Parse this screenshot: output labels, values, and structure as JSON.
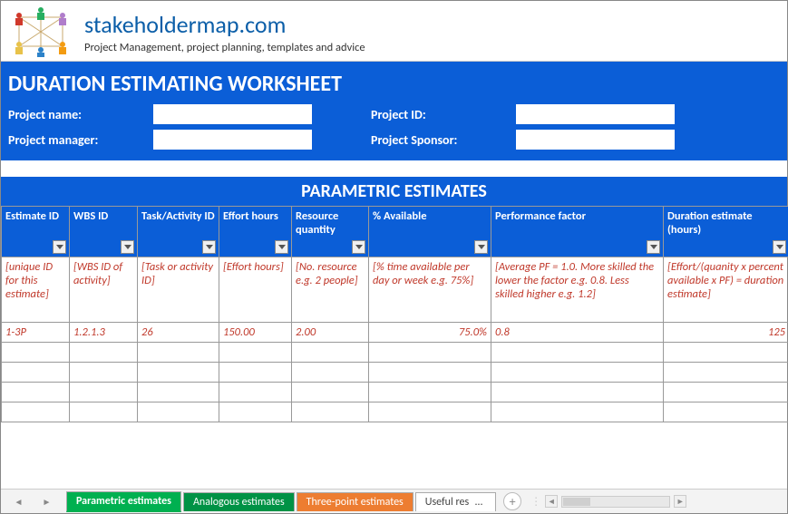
{
  "brand": {
    "site": "stakeholdermap.com",
    "tagline": "Project Management, project planning, templates and advice"
  },
  "title": "DURATION ESTIMATING WORKSHEET",
  "meta": {
    "project_name_label": "Project name:",
    "project_name_value": "",
    "project_id_label": "Project ID:",
    "project_id_value": "",
    "project_manager_label": "Project manager:",
    "project_manager_value": "",
    "project_sponsor_label": "Project Sponsor:",
    "project_sponsor_value": ""
  },
  "section_title": "PARAMETRIC ESTIMATES",
  "columns": {
    "c0": "Estimate ID",
    "c1": "WBS ID",
    "c2": "Task/Activity ID",
    "c3": "Effort hours",
    "c4": "Resource quantity",
    "c5": "% Available",
    "c6": "Performance factor",
    "c7": "Duration estimate (hours)"
  },
  "hints": {
    "c0": "[unique ID for this estimate]",
    "c1": "[WBS ID of activity]",
    "c2": "[Task or activity ID]",
    "c3": "[Effort hours]",
    "c4": "[No. resource e.g. 2 people]",
    "c5": "[% time available per day or week e.g. 75%]",
    "c6": "[Average PF = 1.0. More skilled the lower the factor e.g. 0.8. Less skilled higher e.g. 1.2]",
    "c7": "[Effort/(quanity x percent available x PF) = duration estimate]"
  },
  "row1": {
    "c0": "1-3P",
    "c1": "1.2.1.3",
    "c2": "26",
    "c3": "150.00",
    "c4": "2.00",
    "c5": "75.0%",
    "c6": "0.8",
    "c7": "125"
  },
  "tabs": {
    "t1": "Parametric estimates",
    "t2": "Analogous estimates",
    "t3": "Three-point estimates",
    "t4": "Useful res"
  },
  "colwidths": {
    "w0": 75,
    "w1": 75,
    "w2": 90,
    "w3": 80,
    "w4": 85,
    "w5": 135,
    "w6": 190,
    "w7": 139
  }
}
